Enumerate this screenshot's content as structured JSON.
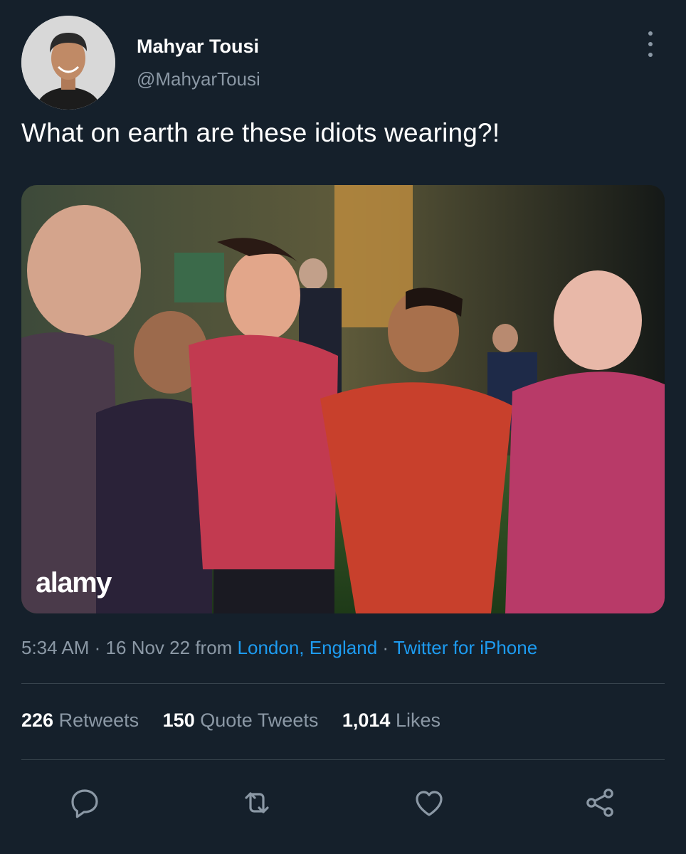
{
  "author": {
    "display_name": "Mahyar Tousi",
    "handle": "@MahyarTousi",
    "avatar_icon": "profile-photo"
  },
  "tweet": {
    "text": "What on earth are these idiots wearing?!",
    "media": {
      "watermark": "alamy"
    },
    "meta": {
      "time": "5:34 AM",
      "date": "16 Nov 22",
      "from_word": "from",
      "location": "London, England",
      "source": "Twitter for iPhone",
      "separator": "·"
    },
    "stats": {
      "retweets_count": "226",
      "retweets_label": "Retweets",
      "quotes_count": "150",
      "quotes_label": "Quote Tweets",
      "likes_count": "1,014",
      "likes_label": "Likes"
    }
  },
  "actions": [
    "reply-icon",
    "retweet-icon",
    "like-icon",
    "share-icon"
  ],
  "colors": {
    "background": "#15202b",
    "text_primary": "#ffffff",
    "text_secondary": "#8b98a5",
    "link": "#1d9bf0",
    "divider": "#38444d"
  }
}
